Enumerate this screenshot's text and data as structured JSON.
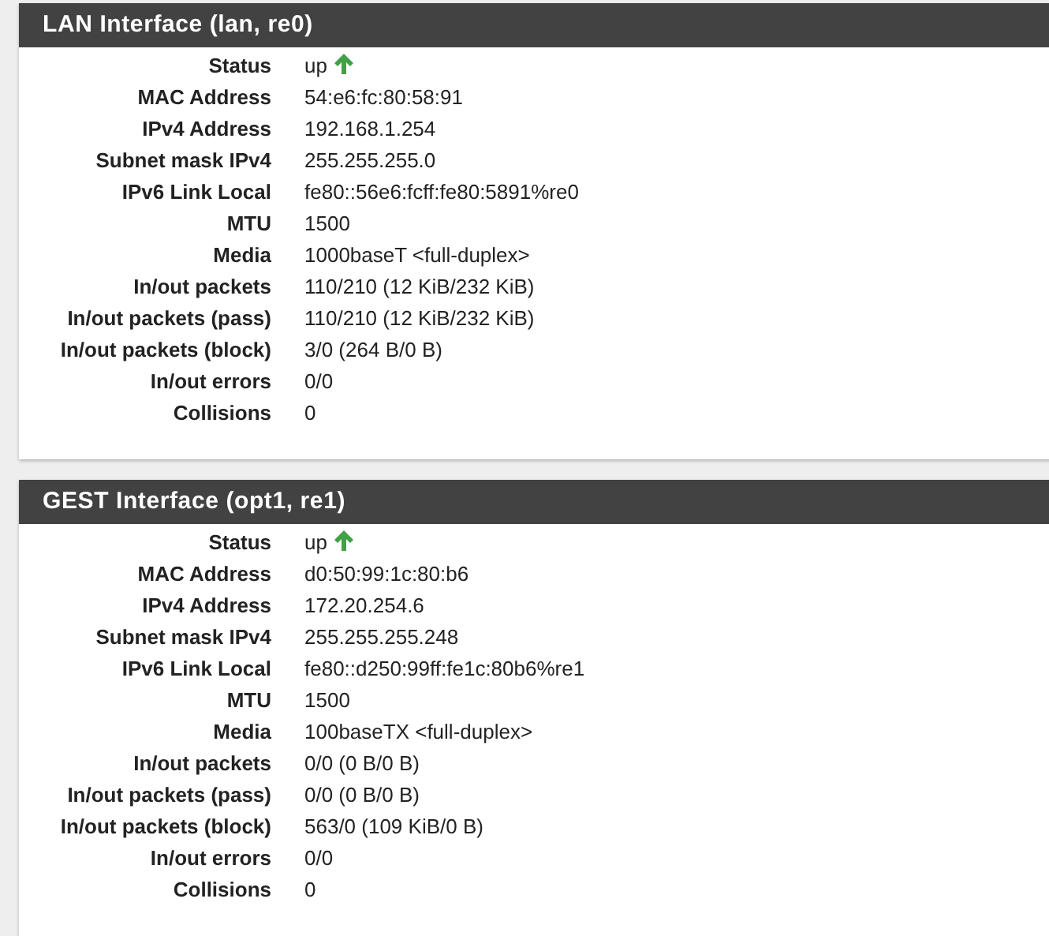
{
  "panels": [
    {
      "title": "LAN Interface (lan, re0)",
      "rows": [
        {
          "kind": "status",
          "label": "Status",
          "value": "up",
          "up": true
        },
        {
          "kind": "text",
          "label": "MAC Address",
          "value": "54:e6:fc:80:58:91"
        },
        {
          "kind": "text",
          "label": "IPv4 Address",
          "value": "192.168.1.254"
        },
        {
          "kind": "text",
          "label": "Subnet mask IPv4",
          "value": "255.255.255.0"
        },
        {
          "kind": "text",
          "label": "IPv6 Link Local",
          "value": "fe80::56e6:fcff:fe80:5891%re0"
        },
        {
          "kind": "text",
          "label": "MTU",
          "value": "1500"
        },
        {
          "kind": "text",
          "label": "Media",
          "value": "1000baseT <full-duplex>"
        },
        {
          "kind": "text",
          "label": "In/out packets",
          "value": "110/210 (12 KiB/232 KiB)"
        },
        {
          "kind": "text",
          "label": "In/out packets (pass)",
          "value": "110/210 (12 KiB/232 KiB)"
        },
        {
          "kind": "text",
          "label": "In/out packets (block)",
          "value": "3/0 (264 B/0 B)"
        },
        {
          "kind": "text",
          "label": "In/out errors",
          "value": "0/0"
        },
        {
          "kind": "text",
          "label": "Collisions",
          "value": "0"
        }
      ]
    },
    {
      "title": "GEST Interface (opt1, re1)",
      "rows": [
        {
          "kind": "status",
          "label": "Status",
          "value": "up",
          "up": true
        },
        {
          "kind": "text",
          "label": "MAC Address",
          "value": "d0:50:99:1c:80:b6"
        },
        {
          "kind": "text",
          "label": "IPv4 Address",
          "value": "172.20.254.6"
        },
        {
          "kind": "text",
          "label": "Subnet mask IPv4",
          "value": "255.255.255.248"
        },
        {
          "kind": "text",
          "label": "IPv6 Link Local",
          "value": "fe80::d250:99ff:fe1c:80b6%re1"
        },
        {
          "kind": "text",
          "label": "MTU",
          "value": "1500"
        },
        {
          "kind": "text",
          "label": "Media",
          "value": "100baseTX <full-duplex>"
        },
        {
          "kind": "text",
          "label": "In/out packets",
          "value": "0/0 (0 B/0 B)"
        },
        {
          "kind": "text",
          "label": "In/out packets (pass)",
          "value": "0/0 (0 B/0 B)"
        },
        {
          "kind": "text",
          "label": "In/out packets (block)",
          "value": "563/0 (109 KiB/0 B)"
        },
        {
          "kind": "text",
          "label": "In/out errors",
          "value": "0/0"
        },
        {
          "kind": "text",
          "label": "Collisions",
          "value": "0"
        }
      ]
    }
  ]
}
